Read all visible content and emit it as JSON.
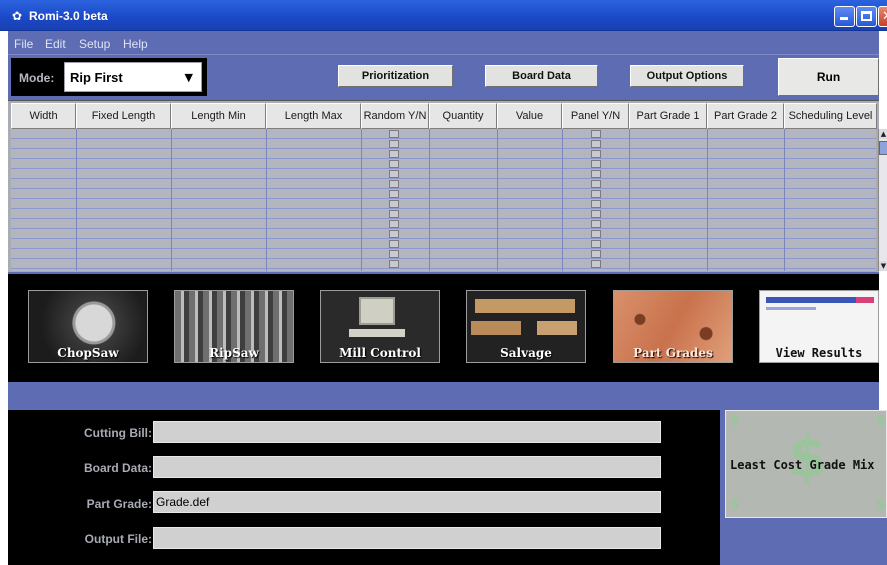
{
  "window": {
    "title": "Romi-3.0 beta"
  },
  "menu": [
    "File",
    "Edit",
    "Setup",
    "Help"
  ],
  "toolbar": {
    "mode_label": "Mode:",
    "mode_value": "Rip First",
    "prioritization": "Prioritization",
    "board_data": "Board Data",
    "output_options": "Output Options",
    "run": "Run"
  },
  "table": {
    "columns": [
      "Width",
      "Fixed Length",
      "Length Min",
      "Length Max",
      "Random Y/N",
      "Quantity",
      "Value",
      "Panel Y/N",
      "Part Grade 1",
      "Part Grade 2",
      "Scheduling Level"
    ],
    "row_count": 14
  },
  "images": [
    {
      "label": "ChopSaw"
    },
    {
      "label": "RipSaw"
    },
    {
      "label": "Mill Control"
    },
    {
      "label": "Salvage"
    },
    {
      "label": "Part Grades"
    },
    {
      "label": "View Results"
    }
  ],
  "files": {
    "cutting_bill_label": "Cutting Bill:",
    "cutting_bill_value": "",
    "board_data_label": "Board Data:",
    "board_data_value": "",
    "part_grade_label": "Part Grade:",
    "part_grade_value": "Grade.def",
    "output_file_label": "Output File:",
    "output_file_value": ""
  },
  "least_cost": {
    "label": "Least Cost Grade Mix"
  }
}
